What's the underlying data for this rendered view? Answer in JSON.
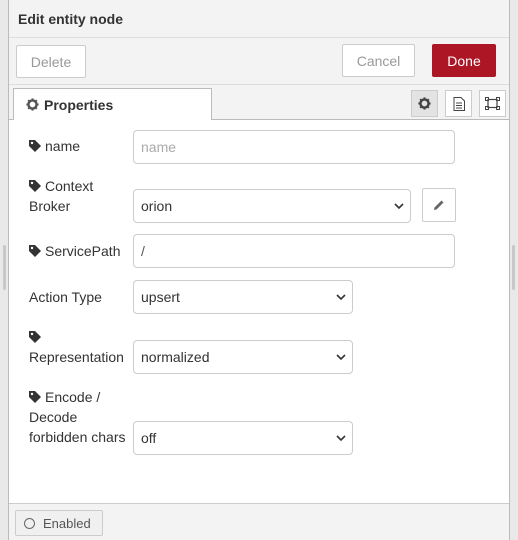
{
  "header": {
    "title": "Edit entity node"
  },
  "toolbar": {
    "delete_label": "Delete",
    "cancel_label": "Cancel",
    "done_label": "Done"
  },
  "tabs": {
    "properties_label": "Properties"
  },
  "form": {
    "name_label": "name",
    "name_placeholder": "name",
    "context_broker_label_line1": "Context",
    "context_broker_label_line2": "Broker",
    "context_broker_value": "orion",
    "service_path_label": "ServicePath",
    "service_path_value": "/",
    "action_type_label": "Action Type",
    "action_type_value": "upsert",
    "representation_label": "Representation",
    "representation_value": "normalized",
    "encode_label_line1": "Encode /",
    "encode_label_line2": "Decode",
    "encode_label_line3": "forbidden chars",
    "encode_value": "off"
  },
  "footer": {
    "enabled_label": "Enabled"
  },
  "colors": {
    "done_button": "#ad1625",
    "panel_bg": "#f3f3f3"
  },
  "icons": [
    "gear-icon",
    "document-icon",
    "frame-icon",
    "tag-icon",
    "pencil-icon",
    "chevron-down-icon",
    "circle-icon"
  ]
}
